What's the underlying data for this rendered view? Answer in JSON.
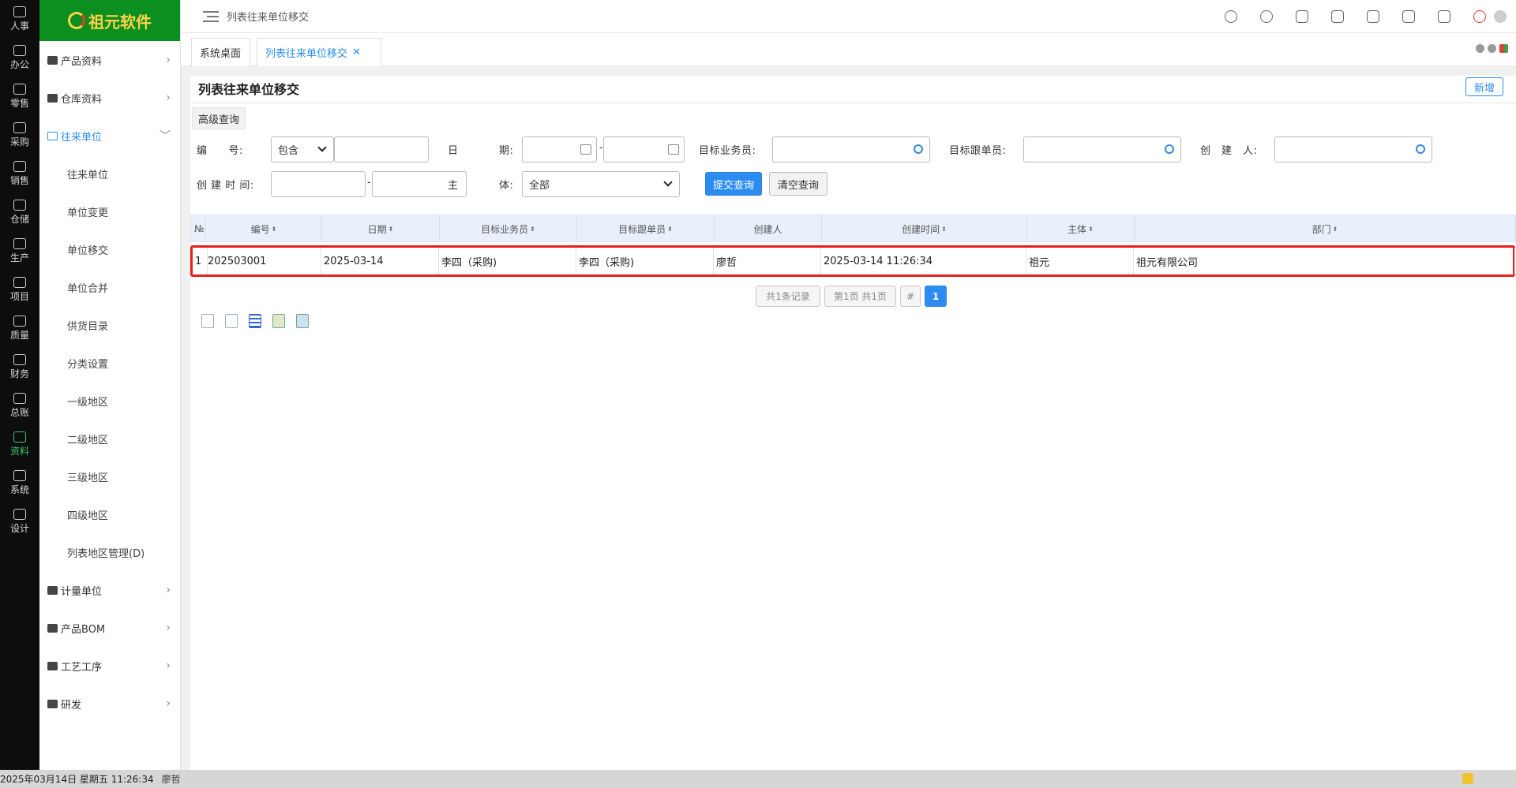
{
  "rail": [
    {
      "label": "人事",
      "icon": "people-icon"
    },
    {
      "label": "办公",
      "icon": "monitor-icon"
    },
    {
      "label": "零售",
      "icon": "store-icon"
    },
    {
      "label": "采购",
      "icon": "truck-icon"
    },
    {
      "label": "销售",
      "icon": "cart-icon"
    },
    {
      "label": "仓储",
      "icon": "boxes-icon"
    },
    {
      "label": "生产",
      "icon": "fingerprint-icon"
    },
    {
      "label": "项目",
      "icon": "layers-icon"
    },
    {
      "label": "质量",
      "icon": "shield-icon"
    },
    {
      "label": "财务",
      "icon": "wallet-icon"
    },
    {
      "label": "总账",
      "icon": "ledger-icon"
    },
    {
      "label": "资料",
      "icon": "document-icon"
    },
    {
      "label": "系统",
      "icon": "gear-icon"
    },
    {
      "label": "设计",
      "icon": "tools-icon"
    }
  ],
  "logo": {
    "text": "祖元软件"
  },
  "sidebar": {
    "groups_top": [
      {
        "label": "产品资料",
        "icon": "folder-icon"
      },
      {
        "label": "仓库资料",
        "icon": "warehouse-icon"
      }
    ],
    "open_group": {
      "label": "往来单位",
      "icon": "building-icon"
    },
    "sub_items": [
      "往来单位",
      "单位变更",
      "单位移交",
      "单位合并",
      "供货目录",
      "分类设置",
      "一级地区",
      "二级地区",
      "三级地区",
      "四级地区",
      "列表地区管理(D)"
    ],
    "groups_bottom": [
      {
        "label": "计量单位",
        "icon": "ruler-icon"
      },
      {
        "label": "产品BOM",
        "icon": "package-icon"
      },
      {
        "label": "工艺工序",
        "icon": "process-icon"
      },
      {
        "label": "研发",
        "icon": "chart-icon"
      }
    ]
  },
  "topbar": {
    "breadcrumb": "列表往来单位移交"
  },
  "tabs": [
    {
      "label": "系统桌面"
    },
    {
      "label": "列表往来单位移交",
      "close": "✕"
    }
  ],
  "page": {
    "title": "列表往来单位移交",
    "add_label": "新增",
    "advanced_label": "高级查询"
  },
  "filters": {
    "code_label": "编　　号:",
    "code_mode": "包含",
    "date_label_a": "日",
    "date_label_b": "期:",
    "salesman_label": "目标业务员:",
    "follower_label": "目标跟单员:",
    "creator_label": "创　建　人:",
    "created_time_label": "创 建 时 间:",
    "entity_label_a": "主",
    "entity_label_b": "体:",
    "entity_value": "全部",
    "dash": "-",
    "submit_label": "提交查询",
    "clear_label": "清空查询"
  },
  "grid": {
    "columns": [
      {
        "label": "№",
        "sortable": false
      },
      {
        "label": "编号",
        "sortable": true
      },
      {
        "label": "日期",
        "sortable": true
      },
      {
        "label": "目标业务员",
        "sortable": true
      },
      {
        "label": "目标跟单员",
        "sortable": true
      },
      {
        "label": "创建人",
        "sortable": false
      },
      {
        "label": "创建时间",
        "sortable": true
      },
      {
        "label": "主体",
        "sortable": true
      },
      {
        "label": "部门",
        "sortable": true
      }
    ],
    "rows": [
      [
        "1",
        "202503001",
        "2025-03-14",
        "李四（采购)",
        "李四（采购)",
        "廖哲",
        "2025-03-14 11:26:34",
        "祖元",
        "祖元有限公司"
      ]
    ],
    "sort_glyph": "⬍"
  },
  "pager": {
    "total": "共1条记录",
    "page_info": "第1页 共1页",
    "jump": "#",
    "current": "1"
  },
  "export_icons": [
    "grid-export-icon",
    "doc-export-icon",
    "calendar-export-icon",
    "excel-export-icon",
    "image-export-icon"
  ],
  "statusbar": {
    "datetime": "2025年03月14日 星期五 11:26:34",
    "user": "廖哲"
  }
}
